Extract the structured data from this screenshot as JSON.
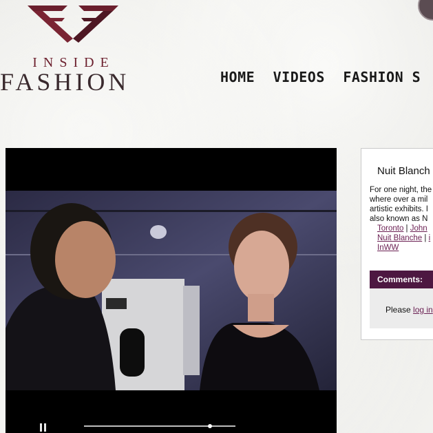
{
  "brand": {
    "line1": "INSIDE",
    "line2": "FASHION",
    "accent_color": "#6b1f2d"
  },
  "nav": {
    "items": [
      "HOME",
      "VIDEOS",
      "FASHION S"
    ]
  },
  "video": {
    "state": "playing",
    "progress": 0.83
  },
  "article": {
    "title": "Nuit Blanch",
    "description_lines": [
      "For one night, the",
      "where over a mil",
      "artistic exhibits. I",
      "also known as N"
    ],
    "tags": [
      {
        "label": "Toronto",
        "sep": " | "
      },
      {
        "label": "John",
        "sep": ""
      }
    ],
    "tags_line2": [
      {
        "label": "Nuit Blanche",
        "sep": " | "
      },
      {
        "label": "i",
        "sep": ""
      }
    ],
    "tag_last": "InWW"
  },
  "comments": {
    "header": "Comments:",
    "prompt": "Please",
    "login_link": "log in",
    "header_color": "#4d1841"
  }
}
